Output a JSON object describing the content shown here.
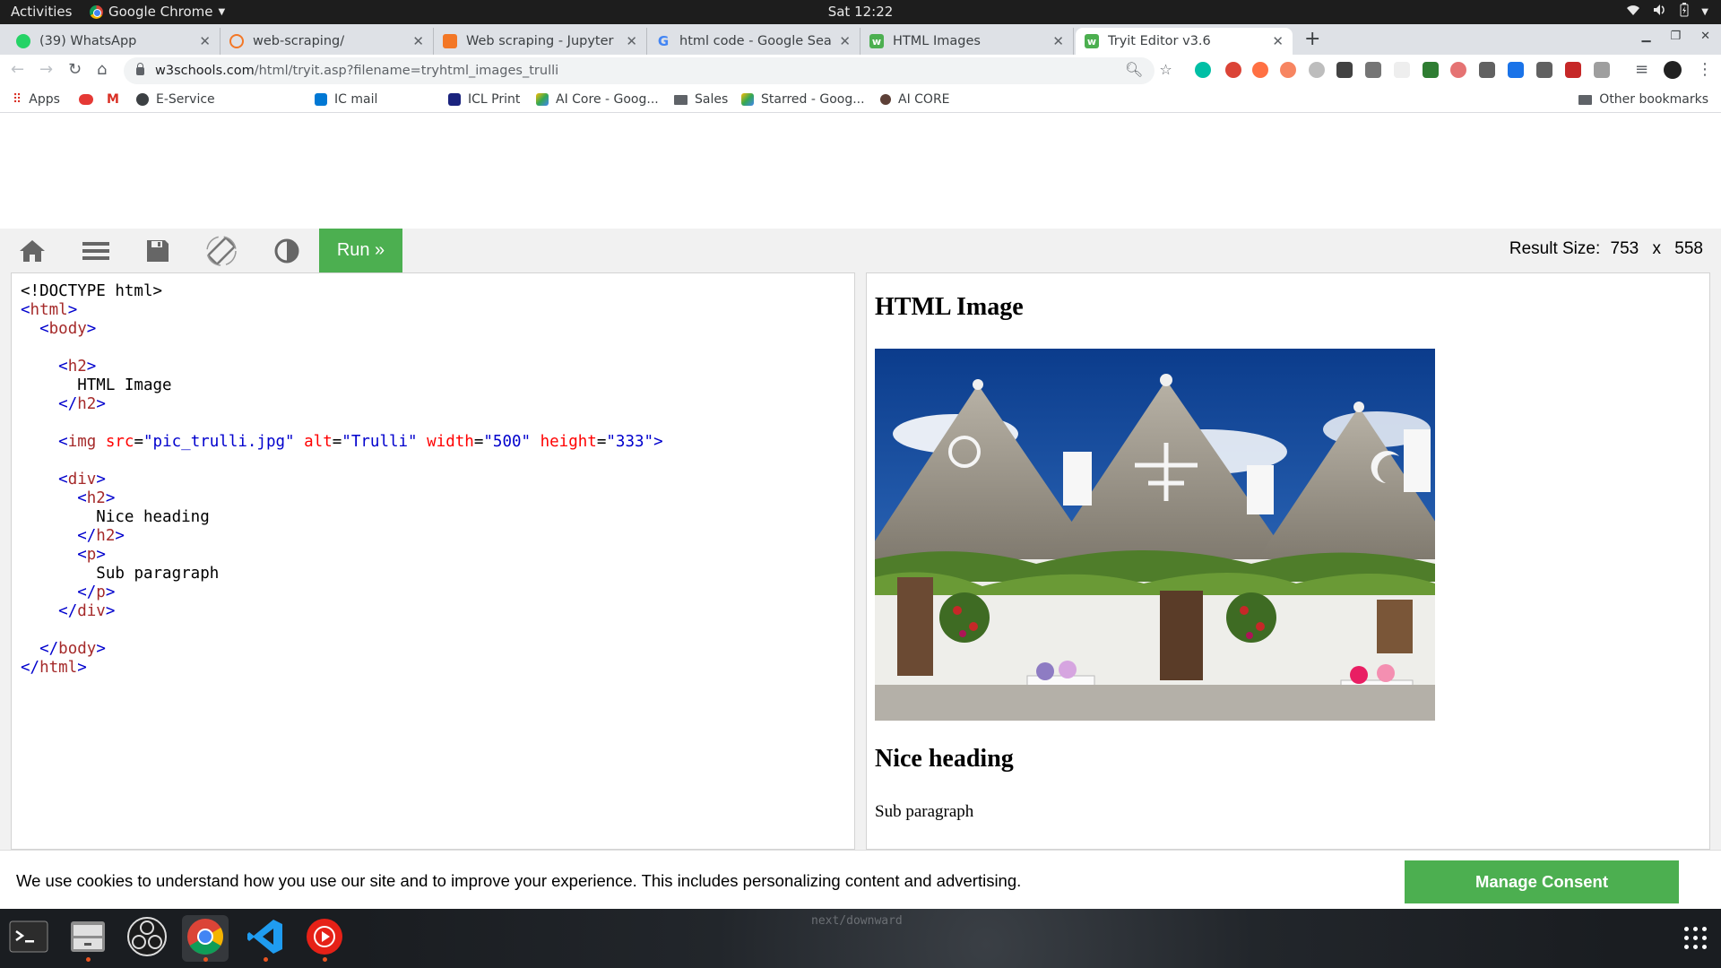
{
  "os": {
    "activities": "Activities",
    "app_name": "Google Chrome",
    "clock": "Sat 12:22"
  },
  "tabs": [
    {
      "label": "(39) WhatsApp",
      "icon": "whatsapp-icon",
      "color": "#25d366"
    },
    {
      "label": "web-scraping/",
      "icon": "jupyter-icon",
      "color": "#f37726"
    },
    {
      "label": "Web scraping - Jupyter No",
      "icon": "jupyter-notebook-icon",
      "color": "#f37726"
    },
    {
      "label": "html code - Google Search",
      "icon": "google-icon",
      "color": "#4285f4"
    },
    {
      "label": "HTML Images",
      "icon": "w3schools-icon",
      "color": "#4caf50"
    },
    {
      "label": "Tryit Editor v3.6",
      "icon": "w3schools-icon",
      "color": "#4caf50"
    }
  ],
  "address": {
    "host": "w3schools.com",
    "path": "/html/tryit.asp?filename=tryhtml_images_trulli"
  },
  "bookmarks": {
    "apps": "Apps",
    "eservice": "E-Service",
    "icmail": "IC mail",
    "iclprint": "ICL Print",
    "aicore_goog": "AI Core - Goog...",
    "sales": "Sales",
    "starred": "Starred - Goog...",
    "aicore": "AI CORE",
    "other": "Other bookmarks"
  },
  "tryit": {
    "run_label": "Run »",
    "result_size_label": "Result Size:",
    "result_width": "753",
    "result_x": "x",
    "result_height": "558"
  },
  "code": {
    "doctype": "<!DOCTYPE html>",
    "h2_text": "HTML Image",
    "img_src": "\"pic_trulli.jpg\"",
    "img_alt": "\"Trulli\"",
    "img_width": "\"500\"",
    "img_height": "\"333\"",
    "nice_heading": "Nice heading",
    "sub_paragraph": "Sub paragraph"
  },
  "result": {
    "heading": "HTML Image",
    "image_alt": "Trulli",
    "nice_heading": "Nice heading",
    "sub_paragraph": "Sub paragraph"
  },
  "cookie": {
    "text": "We use cookies to understand how you use our site and to improve your experience. This includes personalizing content and advertising.",
    "button": "Manage Consent"
  },
  "dock": {
    "hint": "next/downward"
  },
  "colors": {
    "w3_green": "#4caf50",
    "tag": "#a52a2a",
    "attr": "#ff0000",
    "value": "#0000cd"
  }
}
